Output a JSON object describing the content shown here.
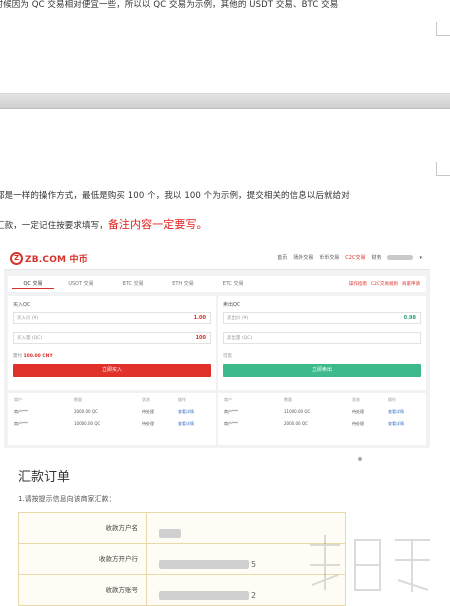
{
  "doc": {
    "line_top": "的时候因为 QC 交易相对便宜一些，所以以 QC 交易为示例，其他的 USDT 交易、BTC 交易",
    "line_mid": "都是一样的操作方式，最低是购买 100 个，我以 100 个为示例，提交相关的信息以后就给对",
    "line_bottom_plain": "汇款，一定记住按要求填写，",
    "line_bottom_red": "备注内容一定要写。"
  },
  "screenshot": {
    "logo_text": "ZB.COM 中币",
    "nav": [
      "首页",
      "场外交易",
      "币币交易",
      "C2C交易",
      "财务"
    ],
    "tabs": [
      "QC 交易",
      "USDT 交易",
      "BTC 交易",
      "ETH 交易",
      "ETC 交易"
    ],
    "tab_links": [
      "操作指南",
      "C2C交易规则",
      "商家申请"
    ],
    "buy": {
      "title": "买入QC",
      "price_label": "买入价 (¥)",
      "price_value": "1.00",
      "amount_label": "买入量 (QC)",
      "amount_value": "100",
      "avail_label": "需付",
      "avail_value": "100.00 CNY",
      "button": "立即买入"
    },
    "sell": {
      "title": "卖出QC",
      "price_label": "卖出价 (¥)",
      "price_value": "0.98",
      "amount_label": "卖出量 (QC)",
      "avail_label": "可卖",
      "button": "立即卖出"
    },
    "order_headers": [
      "商户",
      "数量",
      "状态",
      "操作"
    ],
    "buy_orders": [
      {
        "merchant": "商户***",
        "qty": "2000.00 QC",
        "status": "待处理",
        "action": "查看详情"
      },
      {
        "merchant": "商户***",
        "qty": "10000.00 QC",
        "status": "待处理",
        "action": "查看详情"
      }
    ],
    "sell_orders": [
      {
        "merchant": "商户***",
        "qty": "11000.00 QC",
        "status": "待处理",
        "action": "查看详情"
      },
      {
        "merchant": "商户***",
        "qty": "2000.00 QC",
        "status": "待处理",
        "action": "查看详情"
      }
    ],
    "colors": {
      "brand": "#d6322b",
      "buy_button": "#e0312b",
      "sell_button": "#3cba8c"
    }
  },
  "remit": {
    "title": "汇款订单",
    "subtitle": "1.请按提示信息向该商家汇款：",
    "rows": [
      {
        "label": "收款方户名",
        "tail": ""
      },
      {
        "label": "收款方开户行",
        "tail": "5"
      },
      {
        "label": "收款方账号",
        "tail": "2"
      }
    ]
  }
}
